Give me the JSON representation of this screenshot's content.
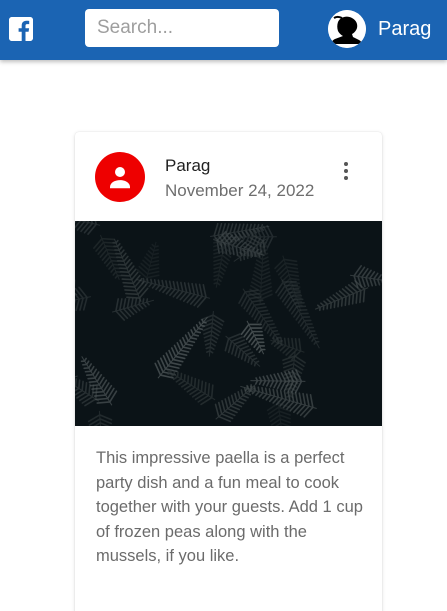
{
  "topbar": {
    "logo_icon": "facebook-icon",
    "search_placeholder": "Search...",
    "search_value": "",
    "user": {
      "name": "Parag",
      "avatar_icon": "user-silhouette-icon"
    },
    "bg_color": "#1b64b3"
  },
  "post": {
    "author": "Parag",
    "date": "November 24, 2022",
    "avatar_icon": "person-icon",
    "avatar_color": "#ee0000",
    "more_icon": "more-vertical-icon",
    "image_desc_icon": "fern-leaves-image",
    "body": "This impressive paella is a perfect party dish and a fun meal to cook together with your guests. Add 1 cup of frozen peas along with the mussels, if you like."
  }
}
